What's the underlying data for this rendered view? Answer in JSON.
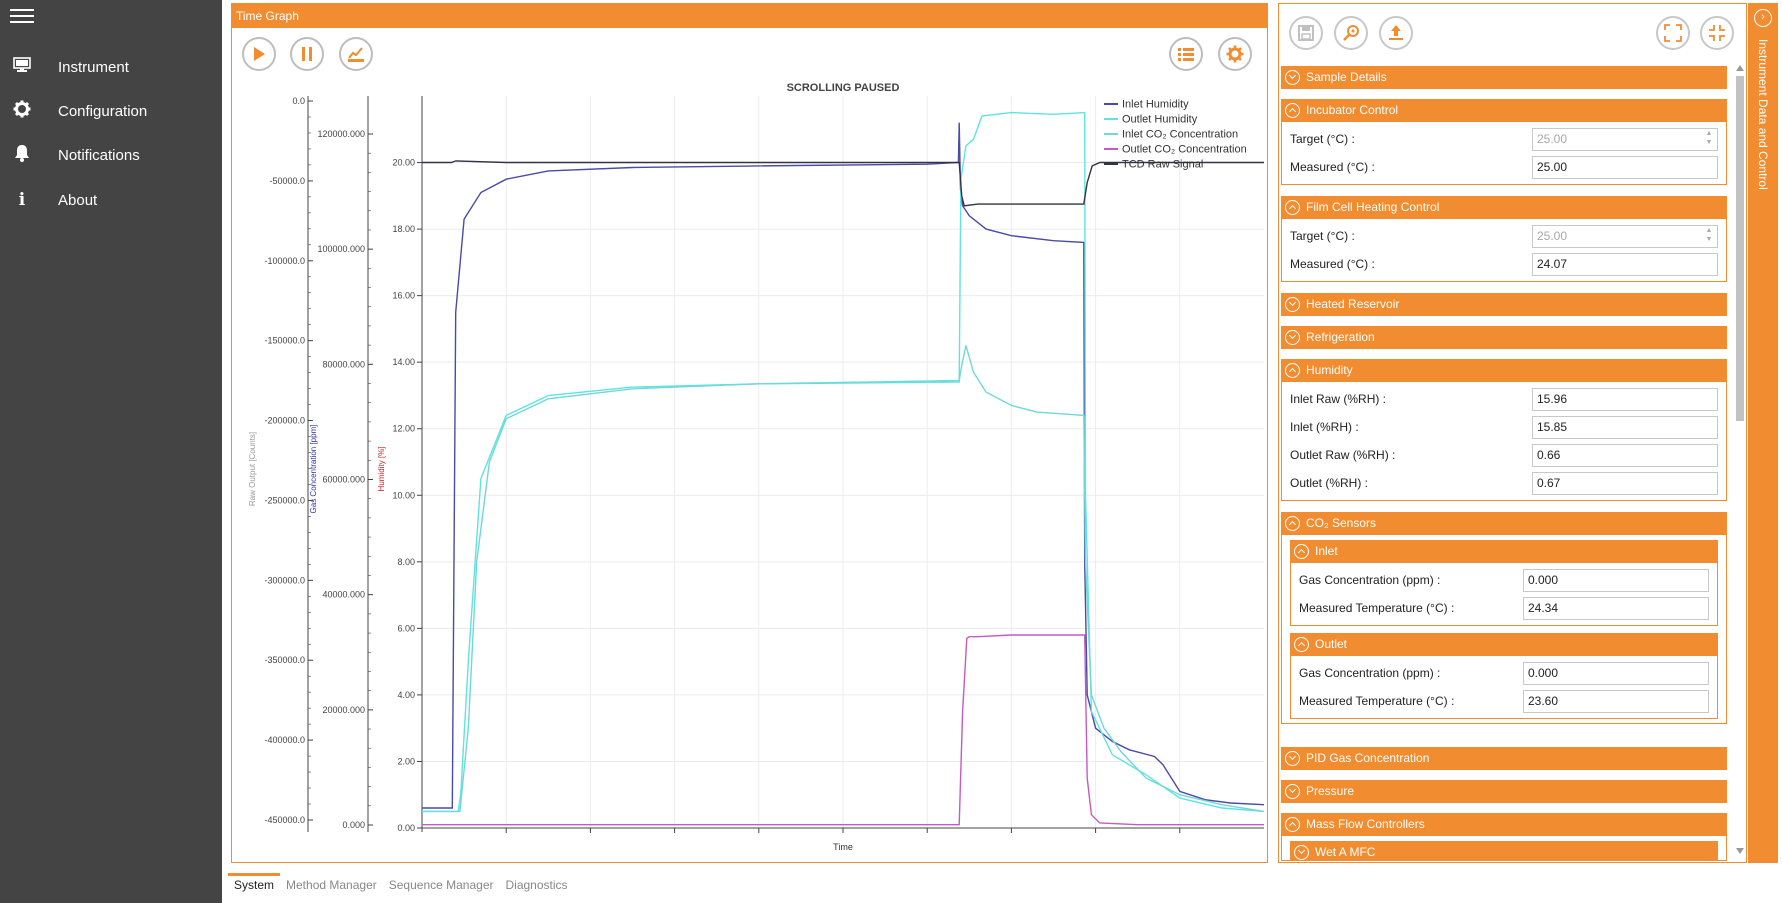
{
  "nav": {
    "items": [
      {
        "label": "Instrument",
        "icon": "monitor-icon"
      },
      {
        "label": "Configuration",
        "icon": "gear-icon"
      },
      {
        "label": "Notifications",
        "icon": "bell-icon"
      },
      {
        "label": "About",
        "icon": "info-icon"
      }
    ]
  },
  "graph_panel": {
    "title": "Time Graph"
  },
  "right_panel": {
    "vertical_tab_label": "Instrument Data and Control",
    "sections": {
      "sample_details": "Sample Details",
      "incubator": {
        "title": "Incubator Control",
        "target_label": "Target (°C) :",
        "target_value": "25.00",
        "measured_label": "Measured (°C) :",
        "measured_value": "25.00"
      },
      "film_cell": {
        "title": "Film Cell Heating Control",
        "target_label": "Target (°C) :",
        "target_value": "25.00",
        "measured_label": "Measured (°C) :",
        "measured_value": "24.07"
      },
      "heated_reservoir": "Heated Reservoir",
      "refrigeration": "Refrigeration",
      "humidity": {
        "title": "Humidity",
        "rows": [
          {
            "label": "Inlet Raw (%RH) :",
            "value": "15.96"
          },
          {
            "label": "Inlet (%RH) :",
            "value": "15.85"
          },
          {
            "label": "Outlet Raw (%RH) :",
            "value": "0.66"
          },
          {
            "label": "Outlet (%RH) :",
            "value": "0.67"
          }
        ]
      },
      "co2": {
        "title": "CO₂ Sensors",
        "inlet": {
          "title": "Inlet",
          "gas_label": "Gas Concentration (ppm) :",
          "gas_value": "0.000",
          "temp_label": "Measured Temperature (°C) :",
          "temp_value": "24.34"
        },
        "outlet": {
          "title": "Outlet",
          "gas_label": "Gas Concentration (ppm) :",
          "gas_value": "0.000",
          "temp_label": "Measured Temperature (°C) :",
          "temp_value": "23.60"
        }
      },
      "pid": "PID Gas Concentration",
      "pressure": "Pressure",
      "mfc": "Mass Flow Controllers",
      "wet_mfc": "Wet A MFC"
    }
  },
  "bottom_tabs": [
    "System",
    "Method Manager",
    "Sequence Manager",
    "Diagnostics"
  ],
  "colors": {
    "accent": "#f28c30",
    "sidebar": "#444444",
    "inlet_humidity": "#4a4aa8",
    "outlet_humidity": "#5fe3e3",
    "inlet_co2": "#6fd8d8",
    "outlet_co2": "#c45ac8",
    "tcd_raw": "#333344"
  },
  "chart_data": {
    "type": "line",
    "title": "SCROLLING PAUSED",
    "xlabel": "Time",
    "axes": [
      {
        "label": "Raw Output [Counts]",
        "color": "#999999",
        "ticks": [
          "0.0",
          "-50000.0",
          "-100000.0",
          "-150000.0",
          "-200000.0",
          "-250000.0",
          "-300000.0",
          "-350000.0",
          "-400000.0",
          "-450000.0"
        ]
      },
      {
        "label": "Gas Concentration [ppm]",
        "color": "#3333aa",
        "ticks": [
          "120000.000",
          "100000.000",
          "80000.000",
          "60000.000",
          "40000.000",
          "20000.000",
          "0.000"
        ]
      },
      {
        "label": "Humidity [%]",
        "color": "#cc2222",
        "ticks": [
          "20.00",
          "18.00",
          "16.00",
          "14.00",
          "12.00",
          "10.00",
          "8.00",
          "6.00",
          "4.00",
          "2.00",
          "0.00"
        ]
      }
    ],
    "ylim": [
      0,
      22
    ],
    "xlim": [
      0,
      100
    ],
    "grid": true,
    "legend": "top-right",
    "series": [
      {
        "name": "Inlet Humidity",
        "color": "#4a4aa8",
        "x": [
          0,
          3.6,
          4.0,
          5.0,
          7,
          10,
          15,
          25,
          40,
          60,
          63.7,
          63.8,
          63.95,
          64.2,
          65,
          67,
          70,
          75,
          78.6,
          78.7,
          79,
          80,
          82,
          84,
          87,
          88,
          90,
          93,
          96,
          100
        ],
        "y": [
          0.6,
          0.6,
          15.5,
          18.3,
          19.1,
          19.5,
          19.75,
          19.85,
          19.9,
          19.95,
          20.0,
          21.2,
          19.2,
          18.7,
          18.4,
          18.0,
          17.8,
          17.65,
          17.6,
          8,
          4,
          3.0,
          2.6,
          2.35,
          2.15,
          1.9,
          1.1,
          0.85,
          0.75,
          0.7
        ]
      },
      {
        "name": "Outlet Humidity",
        "color": "#5fe3e3",
        "x": [
          0,
          4.3,
          4.6,
          5.5,
          7,
          10,
          15,
          25,
          40,
          63.8,
          64.0,
          64.6,
          65.5,
          66.5,
          70,
          75,
          78.7,
          78.8,
          79.5,
          82,
          86,
          90,
          95,
          100
        ],
        "y": [
          0.5,
          0.5,
          1.0,
          5.0,
          10.5,
          12.4,
          13.0,
          13.25,
          13.35,
          13.4,
          19.5,
          20.5,
          20.7,
          21.4,
          21.5,
          21.45,
          21.5,
          10,
          3.5,
          2.2,
          1.6,
          0.9,
          0.6,
          0.5
        ]
      },
      {
        "name": "Inlet CO₂ Concentration",
        "color": "#6fd8d8",
        "x": [
          0,
          4.5,
          5.5,
          6.5,
          8,
          10,
          15,
          25,
          40,
          63.8,
          64.1,
          64.6,
          65.5,
          67,
          70,
          73,
          76,
          78.6,
          78.8,
          79.5,
          81,
          83,
          86,
          90,
          95,
          100
        ],
        "y": [
          0.5,
          0.5,
          3,
          8,
          11,
          12.3,
          12.9,
          13.2,
          13.35,
          13.45,
          13.9,
          14.5,
          13.7,
          13.1,
          12.7,
          12.5,
          12.45,
          12.4,
          8,
          4,
          3.0,
          2.3,
          1.5,
          1.0,
          0.7,
          0.5
        ]
      },
      {
        "name": "Outlet CO₂ Concentration",
        "color": "#c45ac8",
        "x": [
          0,
          63.8,
          64.2,
          64.7,
          65,
          66,
          70,
          75,
          78.7,
          79.0,
          79.5,
          80.5,
          85,
          100
        ],
        "y": [
          0.1,
          0.1,
          3.5,
          5.7,
          5.75,
          5.75,
          5.8,
          5.8,
          5.8,
          1.5,
          0.4,
          0.15,
          0.1,
          0.1
        ]
      },
      {
        "name": "TCD Raw Signal",
        "color": "#333344",
        "x": [
          0,
          3.5,
          4.0,
          10,
          30,
          50,
          63.8,
          64.1,
          64.4,
          66,
          70,
          75,
          78.6,
          79.0,
          79.6,
          80.5,
          85,
          100
        ],
        "y": [
          20.0,
          20.0,
          20.05,
          20.0,
          20.0,
          20.0,
          20.0,
          19.0,
          18.7,
          18.75,
          18.75,
          18.75,
          18.75,
          19.4,
          19.9,
          20.0,
          20.0,
          20.0
        ]
      }
    ]
  }
}
